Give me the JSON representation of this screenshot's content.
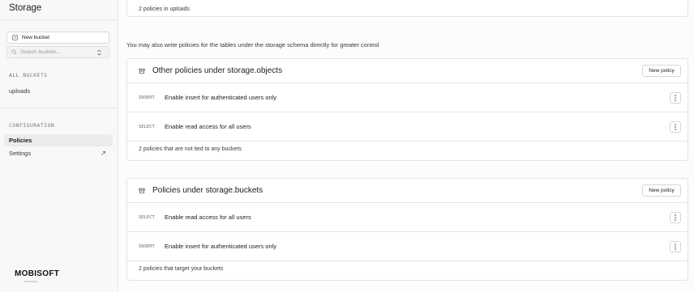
{
  "sidebar": {
    "title": "Storage",
    "new_bucket_label": "New bucket",
    "search_placeholder": "Search buckets...",
    "all_buckets_label": "ALL BUCKETS",
    "buckets": [
      {
        "label": "uploads"
      }
    ],
    "configuration_label": "CONFIGURATION",
    "config_items": [
      {
        "label": "Policies",
        "active": true
      },
      {
        "label": "Settings",
        "active": false
      }
    ],
    "logo_text": "MOBISOFT",
    "logo_sub": "INFOTECH"
  },
  "main": {
    "top_card_footer": "2 policies in uploads",
    "note": "You may also write policies for the tables under the storage schema directly for greater control",
    "objects_card": {
      "title": "Other policies under storage.objects",
      "new_policy_label": "New policy",
      "rows": [
        {
          "command": "INSERT",
          "name": "Enable insert for authenticated users only"
        },
        {
          "command": "SELECT",
          "name": "Enable read access for all users"
        }
      ],
      "footer": "2 policies that are not tied to any buckets"
    },
    "buckets_card": {
      "title": "Policies under storage.buckets",
      "new_policy_label": "New policy",
      "rows": [
        {
          "command": "SELECT",
          "name": "Enable read access for all users"
        },
        {
          "command": "INSERT",
          "name": "Enable insert for authenticated users only"
        }
      ],
      "footer": "2 policies that target your buckets"
    }
  }
}
